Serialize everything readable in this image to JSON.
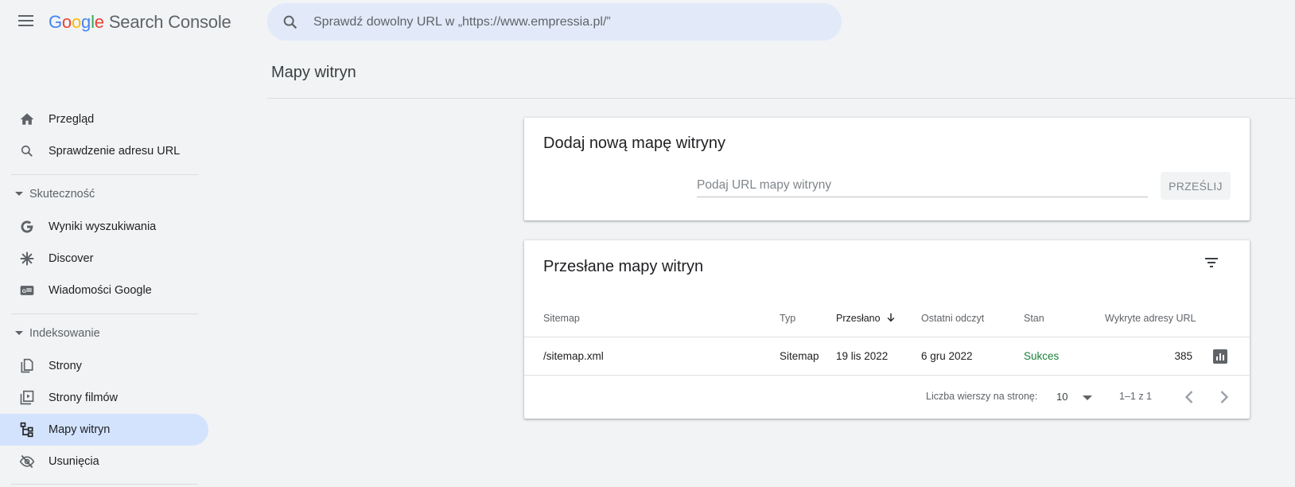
{
  "header": {
    "logo_letters": [
      "G",
      "o",
      "o",
      "g",
      "l",
      "e"
    ],
    "product_name": "Search Console",
    "search_placeholder": "Sprawdź dowolny URL w „https://www.empressia.pl/”"
  },
  "page_title": "Mapy witryn",
  "sidebar": {
    "items_top": [
      {
        "label": "Przegląd",
        "icon": "home-icon"
      },
      {
        "label": "Sprawdzenie adresu URL",
        "icon": "search-icon"
      }
    ],
    "section_performance": {
      "label": "Skuteczność",
      "items": [
        {
          "label": "Wyniki wyszukiwania",
          "icon": "google-g-icon"
        },
        {
          "label": "Discover",
          "icon": "asterisk-icon"
        },
        {
          "label": "Wiadomości Google",
          "icon": "news-icon"
        }
      ]
    },
    "section_indexing": {
      "label": "Indeksowanie",
      "items": [
        {
          "label": "Strony",
          "icon": "pages-icon"
        },
        {
          "label": "Strony filmów",
          "icon": "video-pages-icon"
        },
        {
          "label": "Mapy witryn",
          "icon": "sitemap-icon",
          "active": true
        },
        {
          "label": "Usunięcia",
          "icon": "eye-off-icon"
        }
      ]
    }
  },
  "add_sitemap": {
    "title": "Dodaj nową mapę witryny",
    "input_placeholder": "Podaj URL mapy witryny",
    "submit_label": "PRZEŚLIJ"
  },
  "submitted_sitemaps": {
    "title": "Przesłane mapy witryn",
    "columns": [
      "Sitemap",
      "Typ",
      "Przesłano",
      "Ostatni odczyt",
      "Stan",
      "Wykryte adresy URL"
    ],
    "sorted_column": "Przesłano",
    "rows": [
      {
        "sitemap": "/sitemap.xml",
        "type": "Sitemap",
        "submitted": "19 lis 2022",
        "last_read": "6 gru 2022",
        "status": "Sukces",
        "urls": "385"
      }
    ],
    "footer": {
      "rows_per_page_label": "Liczba wierszy na stronę:",
      "rows_per_page_value": "10",
      "range": "1–1 z 1"
    }
  },
  "colors": {
    "accent": "#1a73e8",
    "active_nav": "#d3e3fd",
    "success": "#188038",
    "search_bg": "#e2eaf9"
  }
}
